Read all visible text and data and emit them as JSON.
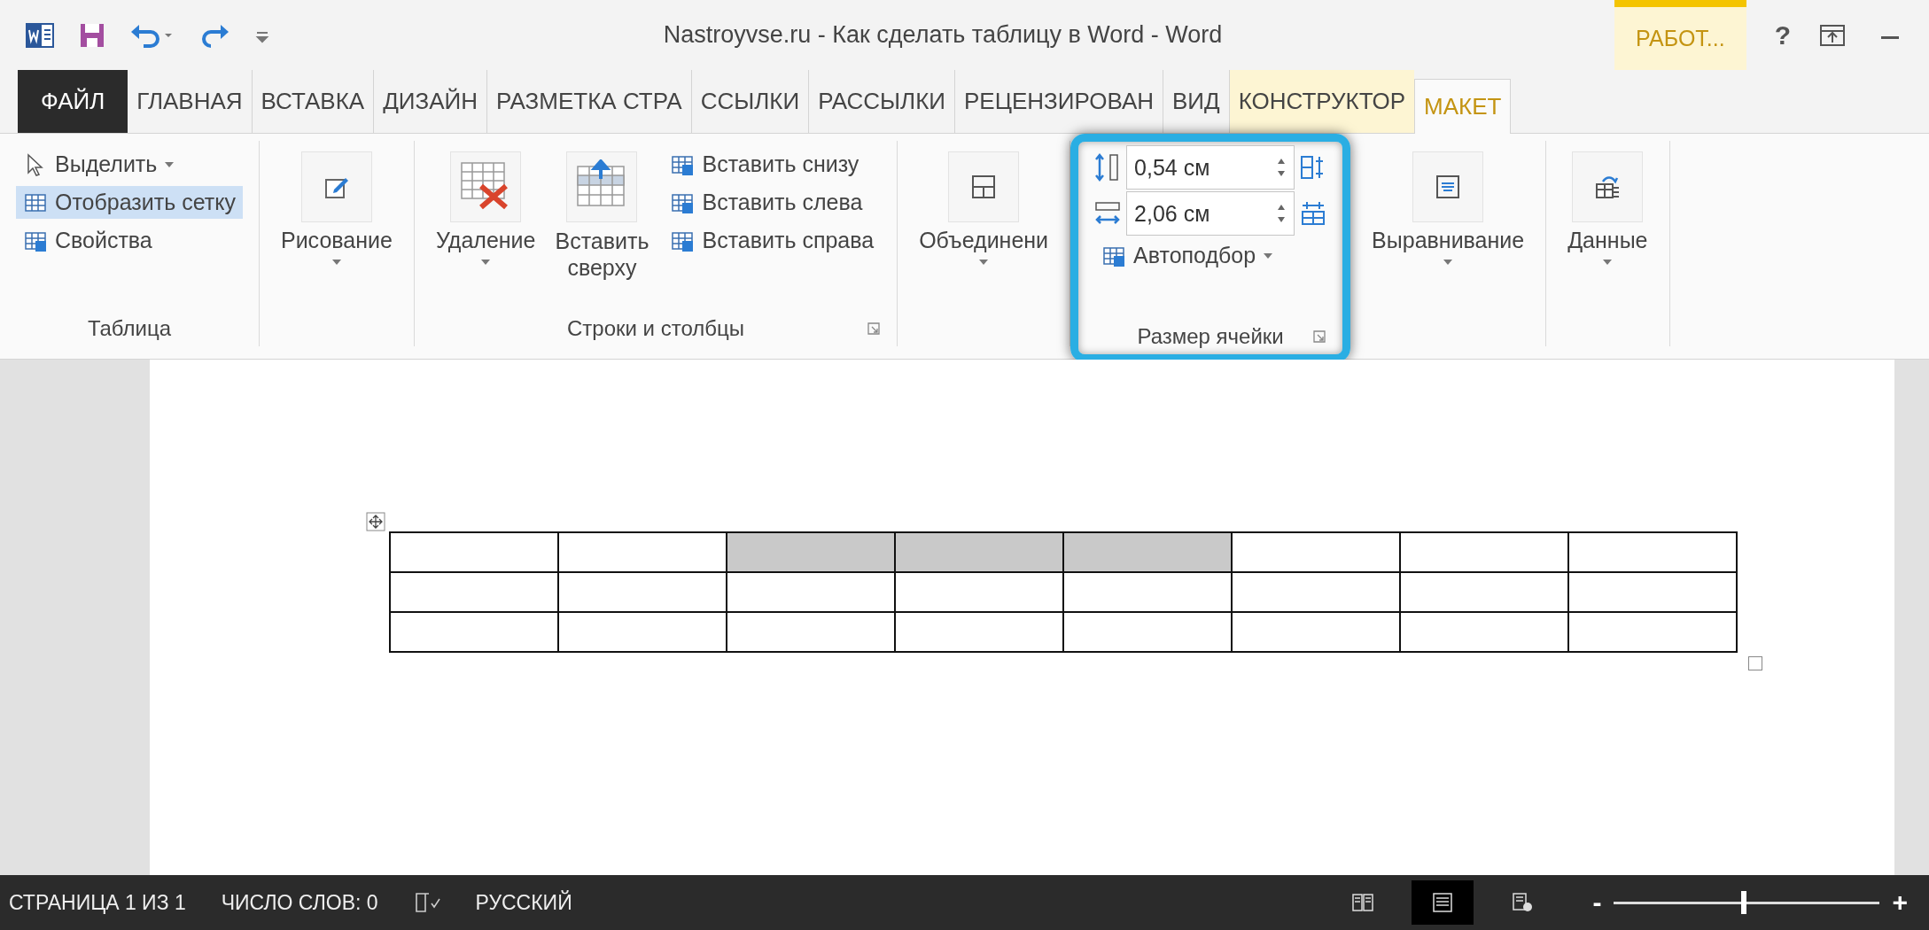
{
  "title_bar": {
    "title": "Nastroyvse.ru - Как сделать таблицу в Word - Word",
    "context_label": "РАБОТ...",
    "help": "?"
  },
  "tabs": [
    {
      "label": "ФАЙЛ",
      "kind": "file",
      "selected": false
    },
    {
      "label": "ГЛАВНАЯ",
      "kind": "normal",
      "selected": false
    },
    {
      "label": "ВСТАВКА",
      "kind": "normal",
      "selected": false
    },
    {
      "label": "ДИЗАЙН",
      "kind": "normal",
      "selected": false
    },
    {
      "label": "РАЗМЕТКА СТРА",
      "kind": "normal",
      "selected": false
    },
    {
      "label": "ССЫЛКИ",
      "kind": "normal",
      "selected": false
    },
    {
      "label": "РАССЫЛКИ",
      "kind": "normal",
      "selected": false
    },
    {
      "label": "РЕЦЕНЗИРОВАН",
      "kind": "normal",
      "selected": false
    },
    {
      "label": "ВИД",
      "kind": "normal",
      "selected": false
    },
    {
      "label": "КОНСТРУКТОР",
      "kind": "context",
      "selected": false
    },
    {
      "label": "МАКЕТ",
      "kind": "context",
      "selected": true
    }
  ],
  "ribbon": {
    "groups": [
      {
        "label": "Таблица",
        "highlighted": false,
        "small_buttons": [
          {
            "label": "Выделить",
            "dropdown": true,
            "selected": false
          },
          {
            "label": "Отобразить сетку",
            "dropdown": false,
            "selected": true
          },
          {
            "label": "Свойства",
            "dropdown": false,
            "selected": false
          }
        ]
      },
      {
        "highlighted": false,
        "large_buttons": [
          {
            "label": "Рисование",
            "dropdown": true,
            "wrap": false
          }
        ]
      },
      {
        "label": "Строки и столбцы",
        "launcher": true,
        "highlighted": false,
        "large_buttons": [
          {
            "label": "Удаление",
            "dropdown": true,
            "wrap": false
          },
          {
            "label": "Вставить сверху",
            "dropdown": false,
            "wrap": true
          }
        ],
        "small_buttons": [
          {
            "label": "Вставить снизу",
            "dropdown": false,
            "selected": false
          },
          {
            "label": "Вставить слева",
            "dropdown": false,
            "selected": false
          },
          {
            "label": "Вставить справа",
            "dropdown": false,
            "selected": false
          }
        ]
      },
      {
        "highlighted": false,
        "large_buttons": [
          {
            "label": "Объединени",
            "dropdown": true,
            "wrap": false
          }
        ]
      },
      {
        "label": "Размер ячейки",
        "launcher": true,
        "highlighted": true,
        "spinners": [
          {
            "value": "0,54 см"
          },
          {
            "value": "2,06 см"
          }
        ],
        "small_buttons": [
          {
            "label": "Автоподбор",
            "dropdown": true,
            "selected": false
          }
        ]
      },
      {
        "highlighted": false,
        "large_buttons": [
          {
            "label": "Выравнивание",
            "dropdown": true,
            "wrap": false
          }
        ]
      },
      {
        "highlighted": false,
        "large_buttons": [
          {
            "label": "Данные",
            "dropdown": true,
            "wrap": false
          }
        ]
      }
    ]
  },
  "table": {
    "rows": [
      {
        "cells": [
          {
            "selected": false
          },
          {
            "selected": false
          },
          {
            "selected": true
          },
          {
            "selected": true
          },
          {
            "selected": true
          },
          {
            "selected": false
          },
          {
            "selected": false
          },
          {
            "selected": false
          }
        ]
      },
      {
        "cells": [
          {
            "selected": false
          },
          {
            "selected": false
          },
          {
            "selected": false
          },
          {
            "selected": false
          },
          {
            "selected": false
          },
          {
            "selected": false
          },
          {
            "selected": false
          },
          {
            "selected": false
          }
        ]
      },
      {
        "cells": [
          {
            "selected": false
          },
          {
            "selected": false
          },
          {
            "selected": false
          },
          {
            "selected": false
          },
          {
            "selected": false
          },
          {
            "selected": false
          },
          {
            "selected": false
          },
          {
            "selected": false
          }
        ]
      }
    ]
  },
  "status_bar": {
    "page": "СТРАНИЦА 1 ИЗ 1",
    "words": "ЧИСЛО СЛОВ: 0",
    "language": "РУССКИЙ",
    "views": [
      {
        "selected": false
      },
      {
        "selected": true
      },
      {
        "selected": false
      }
    ],
    "zoom_out": "-",
    "zoom_in": "+",
    "zoom": {
      "level": 0.49
    }
  }
}
